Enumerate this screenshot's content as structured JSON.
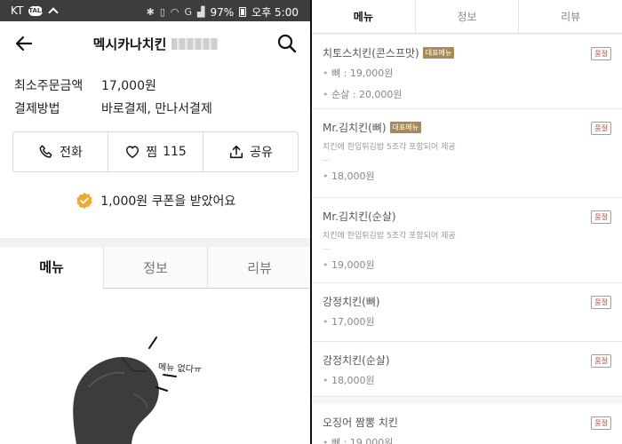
{
  "left": {
    "status": {
      "carrier": "KT",
      "talk": "TALK",
      "battery": "97%",
      "time": "오후 5:00",
      "network": "G"
    },
    "header": {
      "title": "멕시카나치킨"
    },
    "info": [
      {
        "label": "최소주문금액",
        "value": "17,000원"
      },
      {
        "label": "결제방법",
        "value": "바로결제, 만나서결제"
      }
    ],
    "actions": {
      "call": "전화",
      "like": "찜",
      "like_count": "115",
      "share": "공유"
    },
    "coupon": "1,000원 쿠폰을 받았어요",
    "tabs": [
      "메뉴",
      "정보",
      "리뷰"
    ],
    "empty_note": "메뉴 없다ㅠ"
  },
  "right": {
    "tabs": [
      "메뉴",
      "정보",
      "리뷰"
    ],
    "items": [
      {
        "name": "치토스치킨(콘스프맛)",
        "badge": "대표메뉴",
        "sold": "품절",
        "prices": [
          "뼈 : 19,000원",
          "순살 : 20,000원"
        ]
      },
      {
        "name": "Mr.김치킨(뼈)",
        "badge": "대표메뉴",
        "sold": "품절",
        "desc": "치킨에 한입튀김밥 5조각 포함되어 제공",
        "ellipsis": "...",
        "prices": [
          "18,000원"
        ]
      },
      {
        "name": "Mr.김치킨(순살)",
        "sold": "품절",
        "desc": "치킨에 한입튀김밥 5조각 포함되어 제공",
        "ellipsis": "...",
        "prices": [
          "19,000원"
        ]
      },
      {
        "name": "강정치킨(뼈)",
        "sold": "품절",
        "prices": [
          "17,000원"
        ]
      },
      {
        "name": "강정치킨(순살)",
        "sold": "품절",
        "prices": [
          "18,000원"
        ]
      },
      {
        "name": "오징어 짬뽕 치킨",
        "sold": "품절",
        "prices": [
          "뼈 : 19,000원"
        ]
      }
    ]
  },
  "colors": {
    "badge": "#a88a55",
    "sold": "#c0574a",
    "coupon": "#f0a92b",
    "statusbar": "#3d3d3d"
  },
  "icons": [
    "back-arrow-icon",
    "search-icon",
    "phone-icon",
    "heart-icon",
    "share-icon",
    "coupon-check-icon"
  ]
}
